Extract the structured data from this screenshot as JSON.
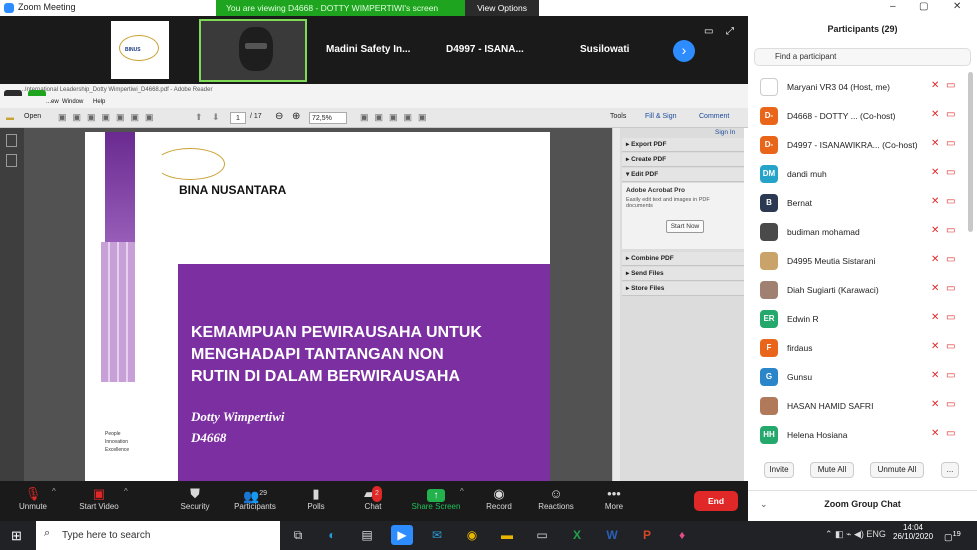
{
  "window": {
    "title": "Zoom Meeting"
  },
  "banner": {
    "message": "You are viewing D4668 - DOTTY WIMPERTIWI's screen",
    "view_options": "View Options"
  },
  "thumbnails": [
    "Madini Safety In...",
    "D4997 - ISANA...",
    "Susilowati"
  ],
  "pdf": {
    "title": "...International Leadership_Dotty Wimpertiwi_D4668.pdf - Adobe Reader",
    "menu": [
      "...ew",
      "Window",
      "Help"
    ],
    "open_label": "Open",
    "page_current": "1",
    "page_total": "/ 17",
    "zoom": "72,5%",
    "tools": "Tools",
    "fill_sign": "Fill & Sign",
    "comment": "Comment",
    "sign_in": "Sign In",
    "panel": {
      "export": "Export PDF",
      "create": "Create PDF",
      "edit": "Edit PDF",
      "promo_title": "Adobe Acrobat Pro",
      "promo_text": "Easily edit text and images in PDF documents",
      "start_now": "Start Now",
      "combine": "Combine PDF",
      "send": "Send Files",
      "store": "Store Files"
    },
    "slide": {
      "brand": "BINA NUSANTARA",
      "heading_lines": [
        "KEMAMPUAN PEWIRAUSAHA UNTUK",
        "MENGHADAPI TANTANGAN NON",
        "RUTIN DI DALAM BERWIRAUSAHA"
      ],
      "author": "Dotty Wimpertiwi",
      "code": "D4668",
      "tagline": [
        "People",
        "Innovation",
        "Excellence"
      ]
    }
  },
  "participants": {
    "header": "Participants (29)",
    "search_placeholder": "Find a participant",
    "list": [
      {
        "initials": "",
        "name": "Maryani VR3 04 (Host, me)",
        "color": "#ffffff"
      },
      {
        "initials": "D-",
        "name": "D4668 - DOTTY ...  (Co-host)",
        "color": "#e8651a"
      },
      {
        "initials": "D-",
        "name": "D4997 - ISANAWIKRA... (Co-host)",
        "color": "#e8651a"
      },
      {
        "initials": "DM",
        "name": "dandi muh",
        "color": "#26a3c9"
      },
      {
        "initials": "B",
        "name": "Bernat",
        "color": "#2b3a52"
      },
      {
        "initials": "",
        "name": "budiman mohamad",
        "color": "#4a4a4a"
      },
      {
        "initials": "",
        "name": "D4995 Meutia Sistarani",
        "color": "#c9a36a"
      },
      {
        "initials": "",
        "name": "Diah Sugiarti (Karawaci)",
        "color": "#a08070"
      },
      {
        "initials": "ER",
        "name": "Edwin R",
        "color": "#25a86b"
      },
      {
        "initials": "F",
        "name": "firdaus",
        "color": "#e8651a"
      },
      {
        "initials": "G",
        "name": "Gunsu",
        "color": "#2b86c9"
      },
      {
        "initials": "",
        "name": "HASAN HAMID SAFRI",
        "color": "#b07a5a"
      },
      {
        "initials": "HH",
        "name": "Helena Hosiana",
        "color": "#25a86b"
      }
    ],
    "invite": "Invite",
    "mute_all": "Mute All",
    "unmute_all": "Unmute All",
    "more": "...",
    "chat_header": "Zoom Group Chat"
  },
  "toolbar": {
    "unmute": "Unmute",
    "start_video": "Start Video",
    "security": "Security",
    "participants": "Participants",
    "participants_count": "29",
    "polls": "Polls",
    "chat": "Chat",
    "chat_badge": "2",
    "share_screen": "Share Screen",
    "record": "Record",
    "reactions": "Reactions",
    "more": "More",
    "end": "End"
  },
  "taskbar": {
    "search_placeholder": "Type here to search",
    "time": "14:04",
    "date": "26/10/2020",
    "notif": "19"
  }
}
